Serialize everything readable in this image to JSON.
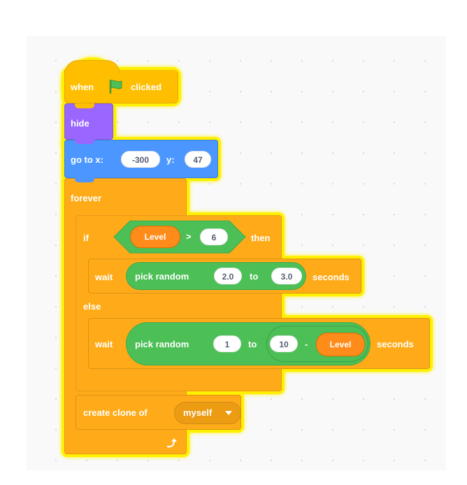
{
  "script": {
    "hat": {
      "when": "when",
      "clicked": "clicked",
      "icon": "green-flag-icon"
    },
    "hide": {
      "label": "hide"
    },
    "goto": {
      "label": "go to x:",
      "x_value": "-300",
      "y_label": "y:",
      "y_value": "47"
    },
    "forever": {
      "label": "forever",
      "loop_icon": "loop-arrow-icon"
    },
    "if_else": {
      "if_label": "if",
      "condition": {
        "variable": "Level",
        "operator": ">",
        "value": "6"
      },
      "then_label": "then",
      "else_label": "else"
    },
    "wait_if": {
      "wait_label": "wait",
      "random_label": "pick random",
      "from": "2.0",
      "to_label": "to",
      "to": "3.0",
      "seconds_label": "seconds"
    },
    "wait_else": {
      "wait_label": "wait",
      "random_label": "pick random",
      "from": "1",
      "to_label": "to",
      "minuend": "10",
      "minus": "-",
      "subtrahend": "Level",
      "seconds_label": "seconds"
    },
    "clone": {
      "label": "create clone of",
      "target": "myself",
      "dropdown_icon": "dropdown-arrow-icon"
    }
  },
  "colors": {
    "events": "#ffbf00",
    "control": "#ffab19",
    "looks": "#9966ff",
    "motion": "#4c97ff",
    "operators": "#4cbf56",
    "variables": "#ff8c1a",
    "highlight": "#fff200"
  }
}
